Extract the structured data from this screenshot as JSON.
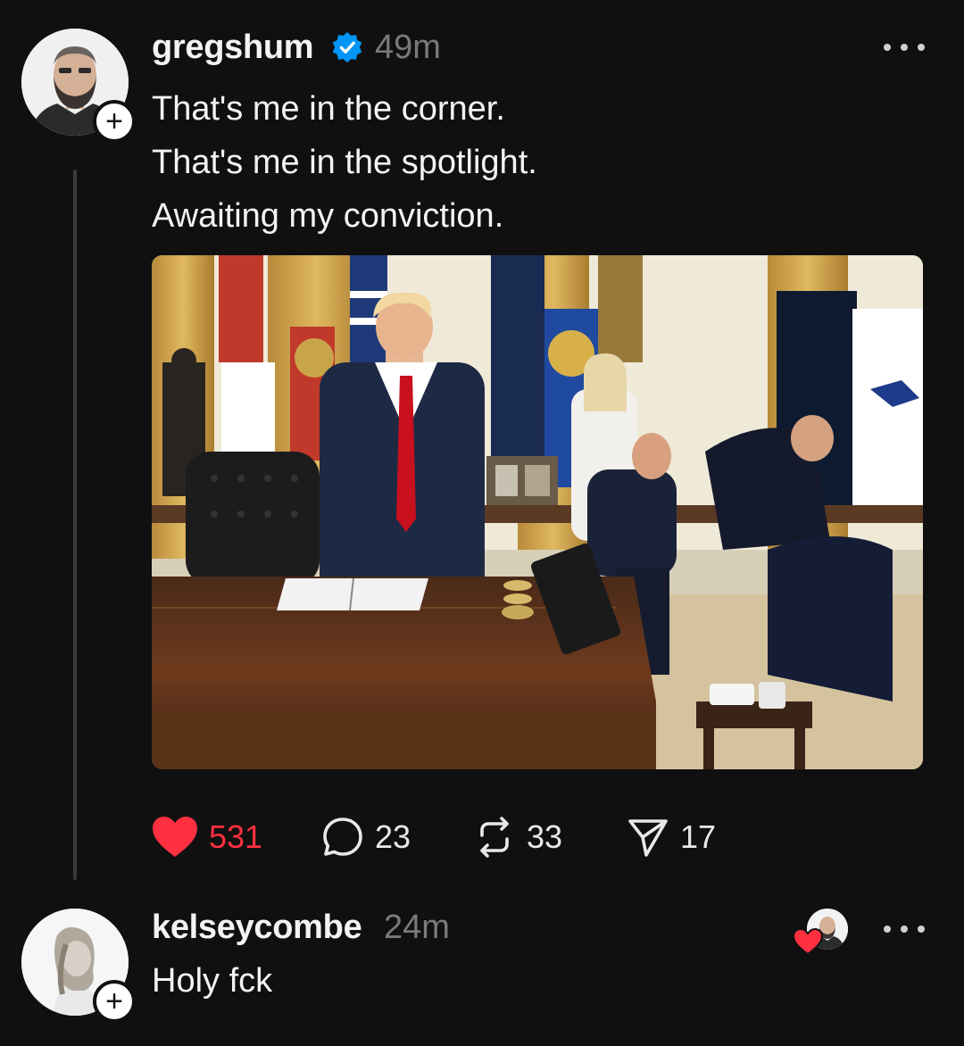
{
  "post": {
    "username": "gregshum",
    "verified": true,
    "time": "49m",
    "text_lines": [
      "That's me in the corner.",
      "That's me in the spotlight.",
      "Awaiting my conviction."
    ],
    "actions": {
      "likes": "531",
      "replies": "23",
      "reposts": "33",
      "shares": "17"
    }
  },
  "reply": {
    "username": "kelseycombe",
    "time": "24m",
    "text": "Holy fck"
  },
  "icons": {
    "follow": "plus-icon",
    "verified": "verified-badge-icon",
    "more": "more-options-icon",
    "like": "heart-icon",
    "reply": "comment-bubble-icon",
    "repost": "repost-icon",
    "share": "send-icon"
  },
  "colors": {
    "background": "#101010",
    "like_red": "#ff3040",
    "verified_blue": "#0095f6",
    "muted": "#7a7a7a"
  }
}
